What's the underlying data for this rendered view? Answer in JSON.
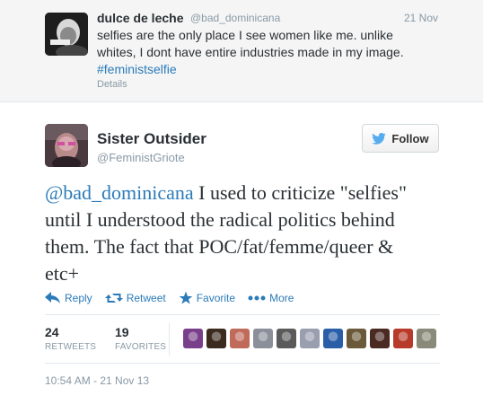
{
  "reply": {
    "name": "dulce de leche",
    "handle": "@bad_dominicana",
    "date": "21 Nov",
    "text_line1": "selfies are the only place I see women like me. unlike",
    "text_line2": "whites, I dont have entire industries made in my image.",
    "hashtag": "#feministselfie",
    "details": "Details"
  },
  "tweet": {
    "name": "Sister Outsider",
    "handle": "@FeministGriote",
    "follow_label": "Follow",
    "mention": "@bad_dominicana",
    "text_rest": " I used to criticize \"selfies\" until I understood the radical politics behind them. The fact that POC/fat/femme/queer & etc+",
    "timestamp": "10:54 AM - 21 Nov 13"
  },
  "actions": {
    "reply": "Reply",
    "retweet": "Retweet",
    "favorite": "Favorite",
    "more": "More"
  },
  "stats": {
    "retweets_count": "24",
    "retweets_label": "RETWEETS",
    "favorites_count": "19",
    "favorites_label": "FAVORITES"
  },
  "colors": {
    "accent": "#2b7bb9",
    "muted": "#8899a6"
  },
  "icons": [
    "reply-icon",
    "retweet-icon",
    "favorite-star-icon",
    "more-dots-icon",
    "twitter-bird-icon"
  ],
  "favoriters": [
    {
      "name": "favoriter-avatar-1",
      "color": "#7a3f8a"
    },
    {
      "name": "favoriter-avatar-2",
      "color": "#3b2a1e"
    },
    {
      "name": "favoriter-avatar-3",
      "color": "#c06a5a"
    },
    {
      "name": "favoriter-avatar-4",
      "color": "#8a8f9a"
    },
    {
      "name": "favoriter-avatar-5",
      "color": "#5a5a5a"
    },
    {
      "name": "favoriter-avatar-6",
      "color": "#9a9fb0"
    },
    {
      "name": "favoriter-avatar-7",
      "color": "#2a5fa8"
    },
    {
      "name": "favoriter-avatar-8",
      "color": "#6b5a3a"
    },
    {
      "name": "favoriter-avatar-9",
      "color": "#4a2a22"
    },
    {
      "name": "favoriter-avatar-10",
      "color": "#b83a2a"
    },
    {
      "name": "favoriter-avatar-11",
      "color": "#8a8a7a"
    }
  ]
}
